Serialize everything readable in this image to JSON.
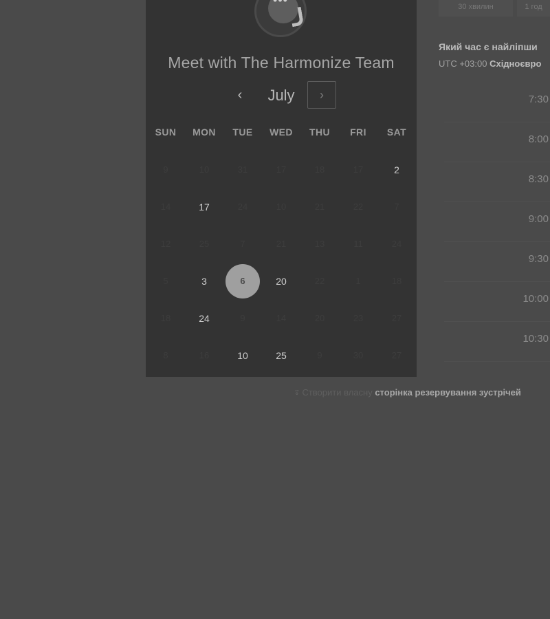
{
  "card": {
    "title": "Meet with The Harmonize Team",
    "month": "July",
    "prev_glyph": "‹",
    "next_glyph": "›",
    "logo_glyph": "•••",
    "weekdays": [
      "SUN",
      "MON",
      "TUE",
      "WED",
      "THU",
      "FRI",
      "SAT"
    ],
    "weeks": [
      [
        {
          "n": "9",
          "s": "off"
        },
        {
          "n": "10",
          "s": "off"
        },
        {
          "n": "31",
          "s": "off"
        },
        {
          "n": "17",
          "s": "off"
        },
        {
          "n": "18",
          "s": "off"
        },
        {
          "n": "17",
          "s": "off"
        },
        {
          "n": "2",
          "s": "avail"
        }
      ],
      [
        {
          "n": "14",
          "s": "off"
        },
        {
          "n": "17",
          "s": "avail"
        },
        {
          "n": "24",
          "s": "off"
        },
        {
          "n": "10",
          "s": "off"
        },
        {
          "n": "21",
          "s": "off"
        },
        {
          "n": "22",
          "s": "off"
        },
        {
          "n": "7",
          "s": "off"
        }
      ],
      [
        {
          "n": "12",
          "s": "off"
        },
        {
          "n": "25",
          "s": "off"
        },
        {
          "n": "7",
          "s": "off"
        },
        {
          "n": "21",
          "s": "off"
        },
        {
          "n": "13",
          "s": "off"
        },
        {
          "n": "11",
          "s": "off"
        },
        {
          "n": "24",
          "s": "off"
        }
      ],
      [
        {
          "n": "5",
          "s": "off"
        },
        {
          "n": "3",
          "s": "avail"
        },
        {
          "n": "6",
          "s": "selected"
        },
        {
          "n": "20",
          "s": "avail"
        },
        {
          "n": "22",
          "s": "off"
        },
        {
          "n": "1",
          "s": "off"
        },
        {
          "n": "18",
          "s": "off"
        }
      ],
      [
        {
          "n": "18",
          "s": "off"
        },
        {
          "n": "24",
          "s": "avail"
        },
        {
          "n": "9",
          "s": "off"
        },
        {
          "n": "14",
          "s": "off"
        },
        {
          "n": "20",
          "s": "off"
        },
        {
          "n": "23",
          "s": "off"
        },
        {
          "n": "27",
          "s": "off"
        }
      ],
      [
        {
          "n": "8",
          "s": "off"
        },
        {
          "n": "16",
          "s": "off"
        },
        {
          "n": "10",
          "s": "avail"
        },
        {
          "n": "25",
          "s": "avail"
        },
        {
          "n": "9",
          "s": "off"
        },
        {
          "n": "30",
          "s": "off"
        },
        {
          "n": "27",
          "s": "off"
        }
      ]
    ]
  },
  "footer": {
    "icon": "hubspot-sprocket-icon",
    "prefix": "Створити власну",
    "link": "сторінка резервування зустрічей"
  },
  "duration_tabs": [
    "30 хвилин",
    "1 год"
  ],
  "times_panel": {
    "heading": "Який час є найліпши",
    "tz_prefix": "UTC +03:00",
    "tz_name": "Східноєвро",
    "slots": [
      "7:30",
      "8:00",
      "8:30",
      "9:00",
      "9:30",
      "10:00",
      "10:30"
    ]
  },
  "colors": {
    "background": "#4a4a4a",
    "card": "#333333",
    "selected_day": "#9f9f9f"
  }
}
